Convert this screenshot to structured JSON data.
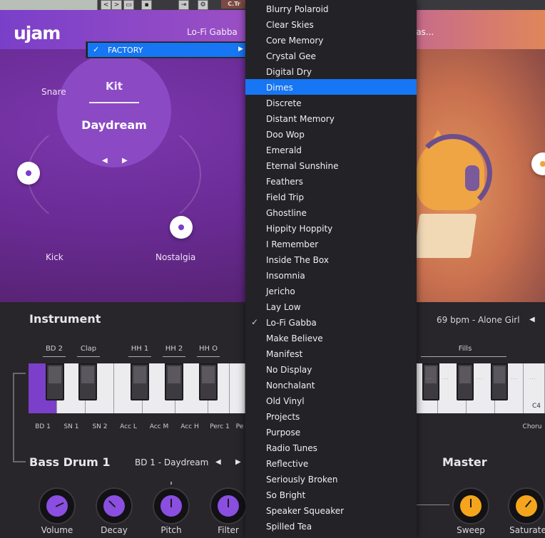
{
  "host": {
    "nav_prev": "<",
    "nav_next": ">",
    "track_label": "C.Tr"
  },
  "header": {
    "logo": "ujam",
    "preset_name": "Lo-Fi Gabba",
    "save_as": "e as..."
  },
  "factory_menu": {
    "label": "FACTORY",
    "checked": true
  },
  "stage": {
    "kit_label": "Kit",
    "kit_value": "Daydream",
    "labels": {
      "snare": "Snare",
      "kick": "Kick",
      "nostalgia": "Nostalgia"
    }
  },
  "instrument": {
    "title": "Instrument",
    "bpm_text": "69 bpm - Alone Girl",
    "groups": [
      "BD 2",
      "Clap",
      "HH 1",
      "HH 2",
      "HH O"
    ],
    "fills_label": "Fills",
    "key_labels": [
      "BD 1",
      "SN 1",
      "SN 2",
      "Acc L",
      "Acc M",
      "Acc H",
      "Perc 1",
      "Pe"
    ],
    "c4_label": "C4",
    "chorus_label": "Choru"
  },
  "bass_drum": {
    "title": "Bass Drum 1",
    "selected": "BD 1 - Daydream",
    "knobs": [
      "Volume",
      "Decay",
      "Pitch",
      "Filter"
    ]
  },
  "master": {
    "title": "Master",
    "knobs": [
      "Sweep",
      "Saturate"
    ]
  },
  "preset_list": {
    "highlighted": "Dimes",
    "checked": "Lo-Fi Gabba",
    "items": [
      "Blurry Polaroid",
      "Clear Skies",
      "Core Memory",
      "Crystal Gee",
      "Digital Dry",
      "Dimes",
      "Discrete",
      "Distant Memory",
      "Doo Wop",
      "Emerald",
      "Eternal Sunshine",
      "Feathers",
      "Field Trip",
      "Ghostline",
      "Hippity Hoppity",
      "I Remember",
      "Inside The Box",
      "Insomnia",
      "Jericho",
      "Lay Low",
      "Lo-Fi Gabba",
      "Make Believe",
      "Manifest",
      "No Display",
      "Nonchalant",
      "Old Vinyl",
      "Projects",
      "Purpose",
      "Radio Tunes",
      "Reflective",
      "Seriously Broken",
      "So Bright",
      "Speaker Squeaker",
      "Spilled Tea"
    ]
  },
  "colors": {
    "accent_purple": "#7b3fc9",
    "accent_orange": "#f4a51c",
    "highlight_blue": "#1676f3"
  }
}
